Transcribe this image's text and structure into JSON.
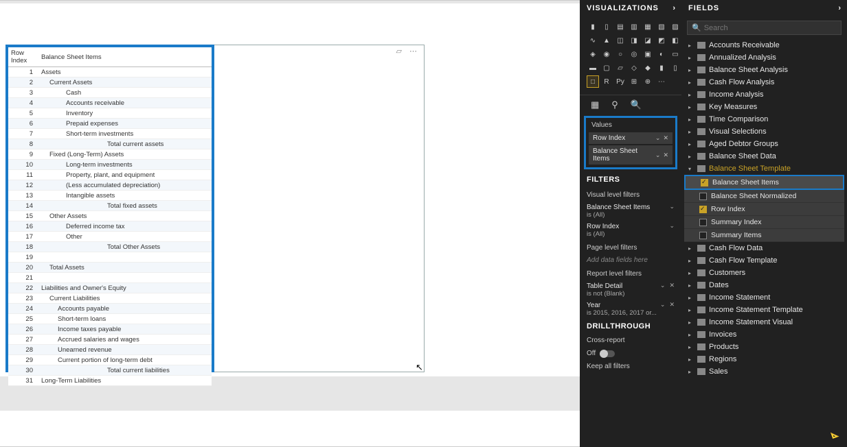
{
  "panels": {
    "viz": "VISUALIZATIONS",
    "fields": "FIELDS"
  },
  "search": {
    "placeholder": "Search"
  },
  "values": {
    "title": "Values",
    "pills": [
      {
        "label": "Row Index"
      },
      {
        "label": "Balance Sheet Items"
      }
    ]
  },
  "filters": {
    "title": "FILTERS",
    "visual_label": "Visual level filters",
    "items": [
      {
        "name": "Balance Sheet Items",
        "sub": "is (All)"
      },
      {
        "name": "Row Index",
        "sub": "is (All)"
      }
    ],
    "page_label": "Page level filters",
    "add": "Add data fields here",
    "report_label": "Report level filters",
    "report_items": [
      {
        "name": "Table Detail",
        "sub": "is not (Blank)"
      },
      {
        "name": "Year",
        "sub": "is 2015, 2016, 2017 or..."
      }
    ]
  },
  "drill": {
    "title": "DRILLTHROUGH",
    "cross": "Cross-report",
    "off": "Off",
    "keep": "Keep all filters"
  },
  "table": {
    "col1": "Row Index",
    "col2": "Balance Sheet Items",
    "rows": [
      {
        "i": 1,
        "t": "Assets",
        "ind": 0
      },
      {
        "i": 2,
        "t": "Current Assets",
        "ind": 1
      },
      {
        "i": 3,
        "t": "Cash",
        "ind": 3
      },
      {
        "i": 4,
        "t": "Accounts receivable",
        "ind": 3
      },
      {
        "i": 5,
        "t": "Inventory",
        "ind": 3
      },
      {
        "i": 6,
        "t": "Prepaid expenses",
        "ind": 3
      },
      {
        "i": 7,
        "t": "Short-term investments",
        "ind": 3
      },
      {
        "i": 8,
        "t": "Total current assets",
        "ind": 8
      },
      {
        "i": 9,
        "t": "Fixed (Long-Term) Assets",
        "ind": 1
      },
      {
        "i": 10,
        "t": "Long-term investments",
        "ind": 3
      },
      {
        "i": 11,
        "t": "Property, plant, and equipment",
        "ind": 3
      },
      {
        "i": 12,
        "t": "(Less accumulated depreciation)",
        "ind": 3
      },
      {
        "i": 13,
        "t": "Intangible assets",
        "ind": 3
      },
      {
        "i": 14,
        "t": "Total fixed assets",
        "ind": 8
      },
      {
        "i": 15,
        "t": "Other Assets",
        "ind": 1
      },
      {
        "i": 16,
        "t": "Deferred income tax",
        "ind": 3
      },
      {
        "i": 17,
        "t": "Other",
        "ind": 3
      },
      {
        "i": 18,
        "t": "Total Other Assets",
        "ind": 8
      },
      {
        "i": 19,
        "t": "",
        "ind": 0
      },
      {
        "i": 20,
        "t": "Total Assets",
        "ind": 1
      },
      {
        "i": 21,
        "t": "",
        "ind": 0
      },
      {
        "i": 22,
        "t": "Liabilities and Owner's Equity",
        "ind": 0
      },
      {
        "i": 23,
        "t": "Current Liabilities",
        "ind": 1
      },
      {
        "i": 24,
        "t": "Accounts payable",
        "ind": 2
      },
      {
        "i": 25,
        "t": "Short-term loans",
        "ind": 2
      },
      {
        "i": 26,
        "t": "Income taxes payable",
        "ind": 2
      },
      {
        "i": 27,
        "t": "Accrued salaries and wages",
        "ind": 2
      },
      {
        "i": 28,
        "t": "Unearned revenue",
        "ind": 2
      },
      {
        "i": 29,
        "t": "Current portion of long-term debt",
        "ind": 2
      },
      {
        "i": 30,
        "t": "Total current liabilities",
        "ind": 8
      },
      {
        "i": 31,
        "t": "Long-Term Liabilities",
        "ind": 0
      }
    ]
  },
  "tree": {
    "groups": [
      {
        "name": "Accounts Receivable"
      },
      {
        "name": "Annualized Analysis"
      },
      {
        "name": "Balance Sheet Analysis"
      },
      {
        "name": "Cash Flow Analysis"
      },
      {
        "name": "Income Analysis"
      },
      {
        "name": "Key Measures"
      },
      {
        "name": "Time Comparison"
      },
      {
        "name": "Visual Selections"
      }
    ],
    "tables": [
      {
        "name": "Aged Debtor Groups"
      },
      {
        "name": "Balance Sheet Data"
      }
    ],
    "active": {
      "name": "Balance Sheet Template"
    },
    "fields": [
      {
        "name": "Balance Sheet Items",
        "checked": true,
        "hl": true
      },
      {
        "name": "Balance Sheet Normalized",
        "checked": false
      },
      {
        "name": "Row Index",
        "checked": true
      },
      {
        "name": "Summary Index",
        "checked": false
      },
      {
        "name": "Summary Items",
        "checked": false
      }
    ],
    "tables2": [
      {
        "name": "Cash Flow Data"
      },
      {
        "name": "Cash Flow Template"
      },
      {
        "name": "Customers"
      },
      {
        "name": "Dates"
      },
      {
        "name": "Income Statement"
      },
      {
        "name": "Income Statement Template"
      },
      {
        "name": "Income Statement Visual"
      },
      {
        "name": "Invoices"
      },
      {
        "name": "Products"
      },
      {
        "name": "Regions"
      },
      {
        "name": "Sales"
      }
    ]
  }
}
